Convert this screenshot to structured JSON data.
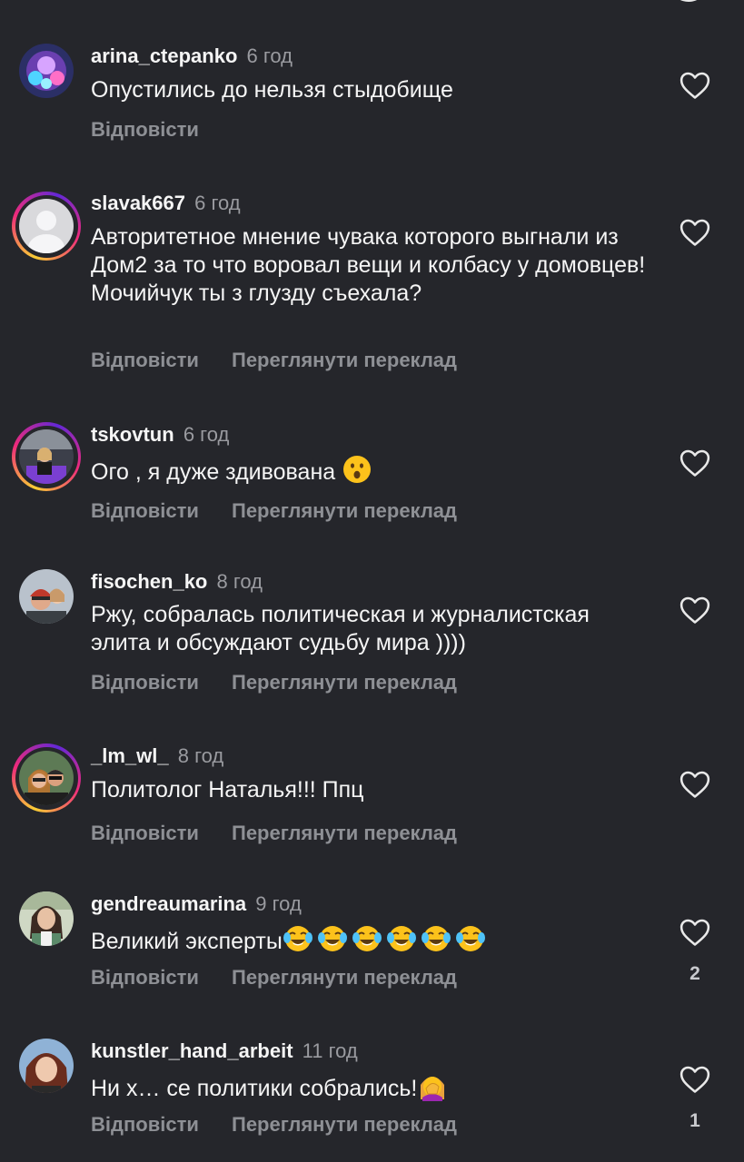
{
  "actions": {
    "reply": "Відповісти",
    "translate": "Переглянути переклад"
  },
  "colors": {
    "background": "#25262b",
    "secondary_text": "#8e9095",
    "story_ring": [
      "#f9ce34",
      "#ee2a7b",
      "#6228d7"
    ]
  },
  "comments": [
    {
      "username": "arina_ctepanko",
      "time": "6 год",
      "text": "Опустились до нельзя стыдобище",
      "has_story_ring": false,
      "show_translate": false,
      "likes": ""
    },
    {
      "username": "slavak667",
      "time": "6 год",
      "text": "Авторитетное мнение чувака которого выгнали из Дом2 за то что воровал вещи и колбасу у домовцев! Мочийчук ты з глузду съехала?",
      "has_story_ring": true,
      "show_translate": true,
      "likes": ""
    },
    {
      "username": "tskovtun",
      "time": "6 год",
      "text": "Ого , я дуже здивована",
      "emoji": "hushed-face-emoji",
      "has_story_ring": true,
      "show_translate": true,
      "likes": ""
    },
    {
      "username": "fisochen_ko",
      "time": "8 год",
      "text": "Ржу, собралась политическая и журналистская элита и обсуждают судьбу мира ))))",
      "has_story_ring": false,
      "show_translate": true,
      "likes": ""
    },
    {
      "username": "_lm_wl_",
      "time": "8 год",
      "text": "Политолог Наталья!!! Ппц",
      "has_story_ring": true,
      "show_translate": true,
      "likes": ""
    },
    {
      "username": "gendreaumarina",
      "time": "9 год",
      "text": "Великий эксперты",
      "emoji": "tears-of-joy-emoji x6",
      "has_story_ring": false,
      "show_translate": true,
      "likes": "2"
    },
    {
      "username": "kunstler_hand_arbeit",
      "time": "11 год",
      "text": "Ни х… се политики собрались!",
      "emoji": "woman-facepalming-emoji",
      "has_story_ring": false,
      "show_translate": true,
      "likes": "1"
    }
  ]
}
